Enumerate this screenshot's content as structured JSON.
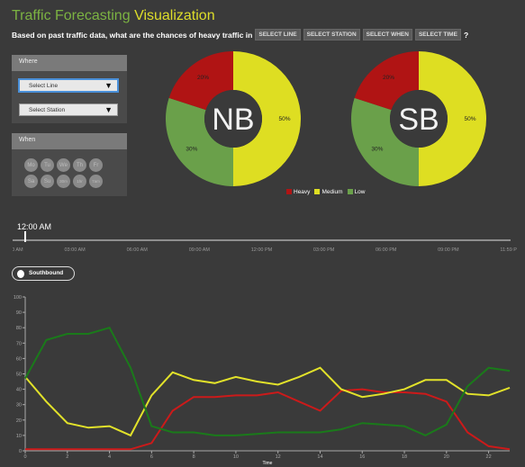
{
  "header": {
    "title_part1": "Traffic Forecasting",
    "title_part2": "Visualization",
    "question_prefix": "Based on past traffic data, what are the chances of heavy traffic in",
    "chips": [
      "SELECT LINE",
      "SELECT STATION",
      "SELECT WHEN",
      "SELECT TIME"
    ],
    "question_suffix": "?"
  },
  "where": {
    "heading": "Where",
    "line_select": "Select Line",
    "station_select": "Select Station"
  },
  "when": {
    "heading": "When",
    "days": [
      "Mo",
      "Tu",
      "We",
      "Th",
      "Fr",
      "Sa",
      "Su",
      "30m",
      "1hr",
      "7am"
    ]
  },
  "donuts": [
    {
      "label": "NB",
      "heavy": 20,
      "medium": 50,
      "low": 30,
      "heavy_label": "20%",
      "medium_label": "50%",
      "low_label": "30%"
    },
    {
      "label": "SB",
      "heavy": 20,
      "medium": 50,
      "low": 30,
      "heavy_label": "20%",
      "medium_label": "50%",
      "low_label": "30%"
    }
  ],
  "legend": {
    "heavy": "Heavy",
    "medium": "Medium",
    "low": "Low"
  },
  "colors": {
    "heavy": "#b01414",
    "medium": "#dede22",
    "low": "#6aa04a",
    "hole": "#3a3a3a"
  },
  "time_slider": {
    "current": "12:00 AM",
    "value_fraction": 0.0,
    "ticks": [
      "12:00 AM",
      "03:00 AM",
      "06:00 AM",
      "09:00 AM",
      "12:00 PM",
      "03:00 PM",
      "06:00 PM",
      "09:00 PM",
      "11:59 PM"
    ]
  },
  "direction_toggle": {
    "label": "Southbound"
  },
  "chart_data": {
    "type": "line",
    "xlabel": "Time",
    "ylabel": "",
    "xlim": [
      0,
      23
    ],
    "ylim": [
      0,
      100
    ],
    "xticks": [
      0,
      2,
      4,
      6,
      8,
      10,
      12,
      14,
      16,
      18,
      20,
      22
    ],
    "yticks": [
      0,
      10,
      20,
      30,
      40,
      50,
      60,
      70,
      80,
      90,
      100
    ],
    "x": [
      0,
      1,
      2,
      3,
      4,
      5,
      6,
      7,
      8,
      9,
      10,
      11,
      12,
      13,
      14,
      15,
      16,
      17,
      18,
      19,
      20,
      21,
      22,
      23
    ],
    "series": [
      {
        "color": "#cc1a1a",
        "values": [
          1,
          1,
          1,
          1,
          1,
          1,
          5,
          26,
          35,
          35,
          36,
          36,
          38,
          32,
          26,
          39,
          40,
          38,
          38,
          37,
          32,
          12,
          3,
          1
        ]
      },
      {
        "color": "#e2e22a",
        "values": [
          48,
          32,
          18,
          15,
          16,
          10,
          36,
          51,
          46,
          44,
          48,
          45,
          43,
          48,
          54,
          40,
          35,
          37,
          40,
          46,
          46,
          37,
          36,
          41
        ]
      },
      {
        "color": "#1a7a1a",
        "values": [
          47,
          72,
          76,
          76,
          80,
          54,
          16,
          12,
          12,
          10,
          10,
          11,
          12,
          12,
          12,
          14,
          18,
          17,
          16,
          10,
          17,
          42,
          54,
          52
        ]
      }
    ]
  }
}
